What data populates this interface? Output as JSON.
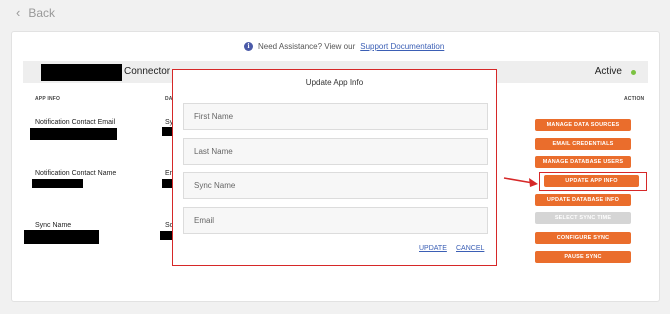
{
  "nav": {
    "back_label": "Back"
  },
  "assistance": {
    "text": "Need Assistance? View our",
    "link": "Support Documentation"
  },
  "header": {
    "connector_label": "Connector",
    "status": "Active",
    "status_color": "#7cc242"
  },
  "table": {
    "columns": [
      "APP INFO",
      "DA",
      "ACTION"
    ],
    "rows": [
      {
        "label": "Notification Contact Email",
        "partial": "Sy"
      },
      {
        "label": "Notification Contact Name",
        "partial": "Er"
      },
      {
        "label": "Sync Name",
        "partial": "Sc"
      }
    ]
  },
  "actions": [
    {
      "label": "MANAGE DATA SOURCES",
      "enabled": true
    },
    {
      "label": "EMAIL CREDENTIALS",
      "enabled": true
    },
    {
      "label": "MANAGE DATABASE USERS",
      "enabled": true
    },
    {
      "label": "UPDATE APP INFO",
      "enabled": true,
      "highlighted": true
    },
    {
      "label": "UPDATE DATABASE INFO",
      "enabled": true
    },
    {
      "label": "SELECT SYNC TIME",
      "enabled": false
    },
    {
      "label": "CONFIGURE SYNC",
      "enabled": true
    },
    {
      "label": "PAUSE SYNC",
      "enabled": true
    }
  ],
  "modal": {
    "title": "Update App Info",
    "fields": [
      {
        "placeholder": "First Name"
      },
      {
        "placeholder": "Last Name"
      },
      {
        "placeholder": "Sync Name"
      },
      {
        "placeholder": "Email"
      }
    ],
    "update_label": "UPDATE",
    "cancel_label": "CANCEL"
  },
  "colors": {
    "accent": "#ea6d2c",
    "disabled": "#d5d5d5",
    "annotation": "#d62828",
    "link": "#3b5fb5"
  }
}
